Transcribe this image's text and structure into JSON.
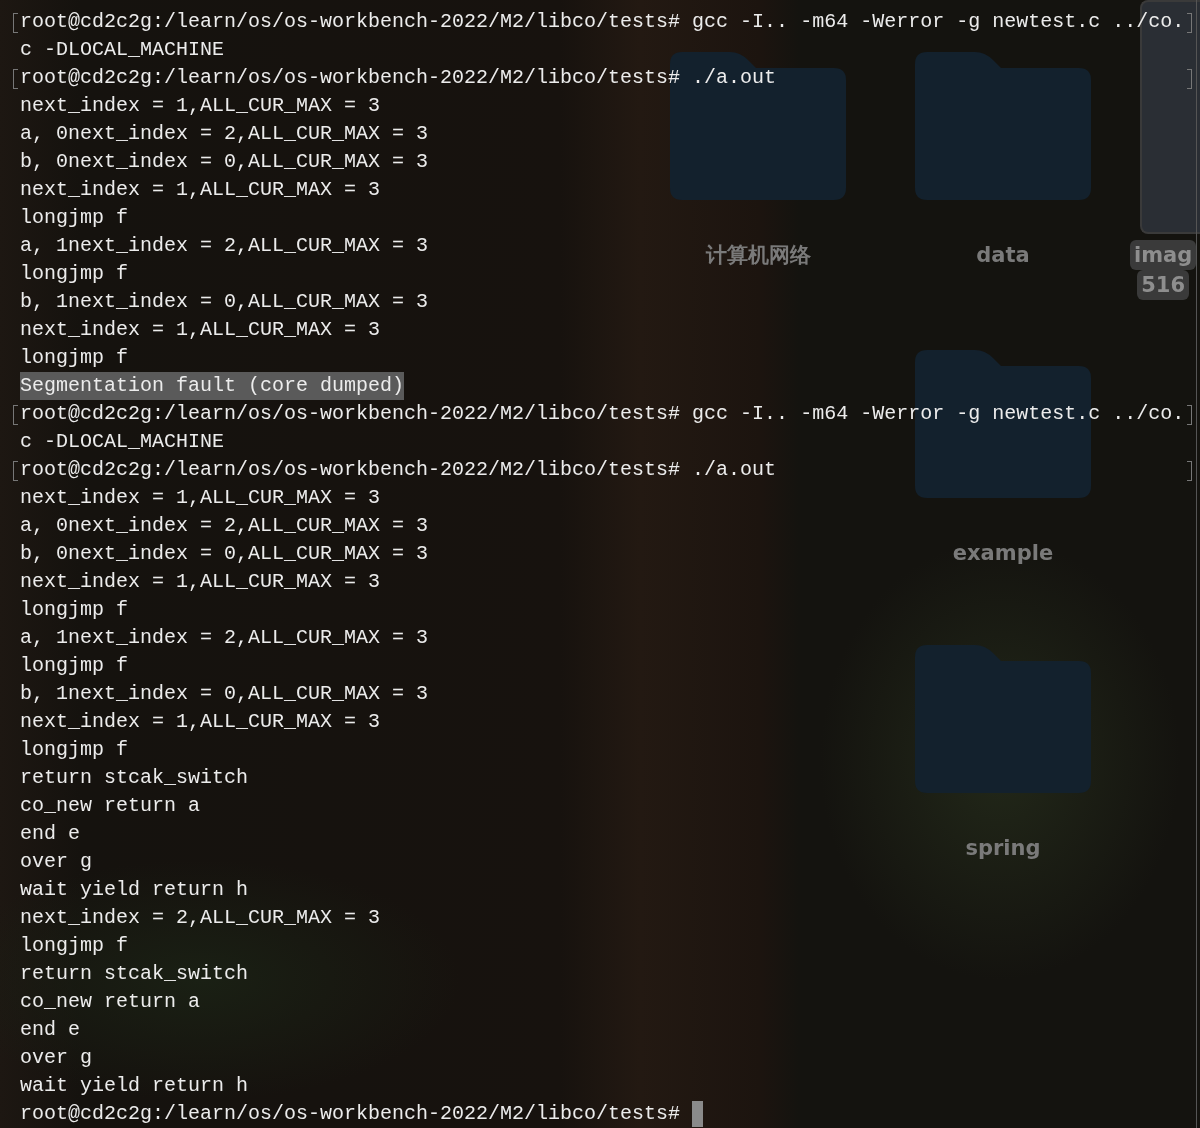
{
  "terminal": {
    "lines": [
      {
        "kind": "command",
        "text": "root@cd2c2g:/learn/os/os-workbench-2022/M2/libco/tests# gcc -I.. -m64 -Werror -g newtest.c ../co."
      },
      {
        "kind": "output",
        "text": "c -DLOCAL_MACHINE"
      },
      {
        "kind": "command",
        "text": "root@cd2c2g:/learn/os/os-workbench-2022/M2/libco/tests# ./a.out"
      },
      {
        "kind": "output",
        "text": "next_index = 1,ALL_CUR_MAX = 3"
      },
      {
        "kind": "output",
        "text": "a, 0next_index = 2,ALL_CUR_MAX = 3"
      },
      {
        "kind": "output",
        "text": "b, 0next_index = 0,ALL_CUR_MAX = 3"
      },
      {
        "kind": "output",
        "text": "next_index = 1,ALL_CUR_MAX = 3"
      },
      {
        "kind": "output",
        "text": "longjmp f"
      },
      {
        "kind": "output",
        "text": "a, 1next_index = 2,ALL_CUR_MAX = 3"
      },
      {
        "kind": "output",
        "text": "longjmp f"
      },
      {
        "kind": "output",
        "text": "b, 1next_index = 0,ALL_CUR_MAX = 3"
      },
      {
        "kind": "output",
        "text": "next_index = 1,ALL_CUR_MAX = 3"
      },
      {
        "kind": "output",
        "text": "longjmp f"
      },
      {
        "kind": "highlight",
        "text": "Segmentation fault (core dumped)"
      },
      {
        "kind": "command",
        "text": "root@cd2c2g:/learn/os/os-workbench-2022/M2/libco/tests# gcc -I.. -m64 -Werror -g newtest.c ../co."
      },
      {
        "kind": "output",
        "text": "c -DLOCAL_MACHINE"
      },
      {
        "kind": "command",
        "text": "root@cd2c2g:/learn/os/os-workbench-2022/M2/libco/tests# ./a.out"
      },
      {
        "kind": "output",
        "text": "next_index = 1,ALL_CUR_MAX = 3"
      },
      {
        "kind": "output",
        "text": "a, 0next_index = 2,ALL_CUR_MAX = 3"
      },
      {
        "kind": "output",
        "text": "b, 0next_index = 0,ALL_CUR_MAX = 3"
      },
      {
        "kind": "output",
        "text": "next_index = 1,ALL_CUR_MAX = 3"
      },
      {
        "kind": "output",
        "text": "longjmp f"
      },
      {
        "kind": "output",
        "text": "a, 1next_index = 2,ALL_CUR_MAX = 3"
      },
      {
        "kind": "output",
        "text": "longjmp f"
      },
      {
        "kind": "output",
        "text": "b, 1next_index = 0,ALL_CUR_MAX = 3"
      },
      {
        "kind": "output",
        "text": "next_index = 1,ALL_CUR_MAX = 3"
      },
      {
        "kind": "output",
        "text": "longjmp f"
      },
      {
        "kind": "output",
        "text": "return stcak_switch"
      },
      {
        "kind": "output",
        "text": "co_new return a"
      },
      {
        "kind": "output",
        "text": "end e"
      },
      {
        "kind": "output",
        "text": "over g"
      },
      {
        "kind": "output",
        "text": "wait yield return h"
      },
      {
        "kind": "output",
        "text": "next_index = 2,ALL_CUR_MAX = 3"
      },
      {
        "kind": "output",
        "text": "longjmp f"
      },
      {
        "kind": "output",
        "text": "return stcak_switch"
      },
      {
        "kind": "output",
        "text": "co_new return a"
      },
      {
        "kind": "output",
        "text": "end e"
      },
      {
        "kind": "output",
        "text": "over g"
      },
      {
        "kind": "output",
        "text": "wait yield return h"
      },
      {
        "kind": "prompt",
        "text": "root@cd2c2g:/learn/os/os-workbench-2022/M2/libco/tests#"
      }
    ]
  },
  "desktop_icons": [
    {
      "kind": "folder",
      "labels": [
        "计算机网络"
      ],
      "selected": false
    },
    {
      "kind": "folder",
      "labels": [
        "data"
      ],
      "selected": false
    },
    {
      "kind": "image",
      "labels": [
        "imag",
        "516"
      ],
      "selected": true
    },
    {
      "kind": "folder",
      "labels": [
        "example"
      ],
      "selected": false
    },
    {
      "kind": "folder",
      "labels": [
        "spring"
      ],
      "selected": false
    }
  ]
}
